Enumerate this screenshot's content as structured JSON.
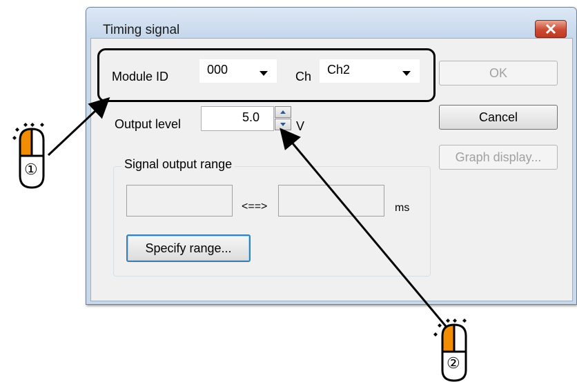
{
  "dialog": {
    "title": "Timing signal",
    "module_label": "Module ID",
    "module_value": "000",
    "ch_label": "Ch",
    "ch_value": "Ch2",
    "output_label": "Output level",
    "output_value": "5.0",
    "output_unit": "V",
    "group_title": "Signal output range",
    "range_sep": "<==>",
    "range_unit": "ms",
    "range_from": "",
    "range_to": "",
    "specify_btn": "Specify range...",
    "ok_btn": "OK",
    "cancel_btn": "Cancel",
    "graph_btn": "Graph display..."
  },
  "annotations": {
    "mouse1_number": "①",
    "mouse2_number": "②"
  },
  "colors": {
    "mouse_button": "#f28c00",
    "close_button": "#c8442e"
  }
}
